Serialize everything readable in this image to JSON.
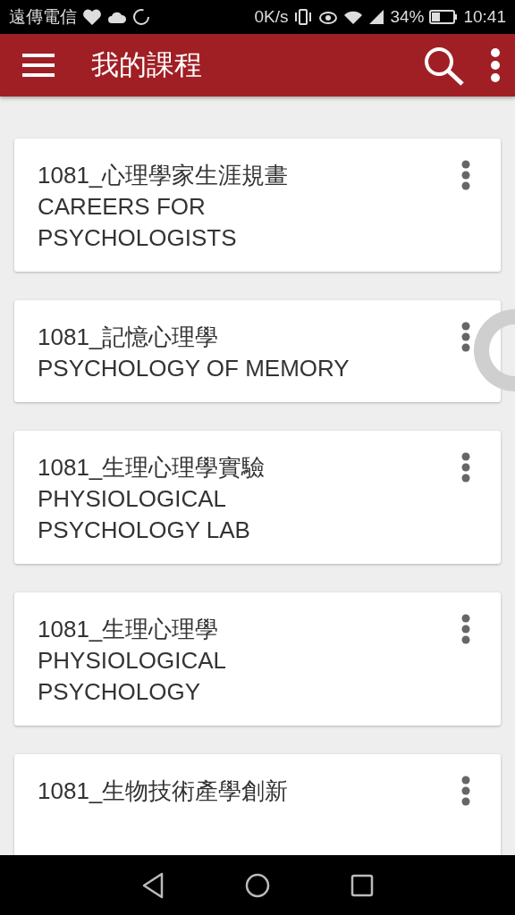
{
  "status_bar": {
    "carrier": "遠傳電信",
    "speed": "0K/s",
    "battery": "34%",
    "time": "10:41"
  },
  "app_bar": {
    "title": "我的課程"
  },
  "courses": [
    {
      "title": "1081_心理學家生涯規畫",
      "subtitle_lines": [
        "CAREERS FOR",
        "PSYCHOLOGISTS"
      ]
    },
    {
      "title": "1081_記憶心理學",
      "subtitle_lines": [
        "PSYCHOLOGY OF MEMORY"
      ]
    },
    {
      "title": "1081_生理心理學實驗",
      "subtitle_lines": [
        "PHYSIOLOGICAL",
        "PSYCHOLOGY LAB"
      ]
    },
    {
      "title": "1081_生理心理學",
      "subtitle_lines": [
        "PHYSIOLOGICAL",
        "PSYCHOLOGY"
      ]
    },
    {
      "title": "1081_生物技術產學創新"
    }
  ]
}
